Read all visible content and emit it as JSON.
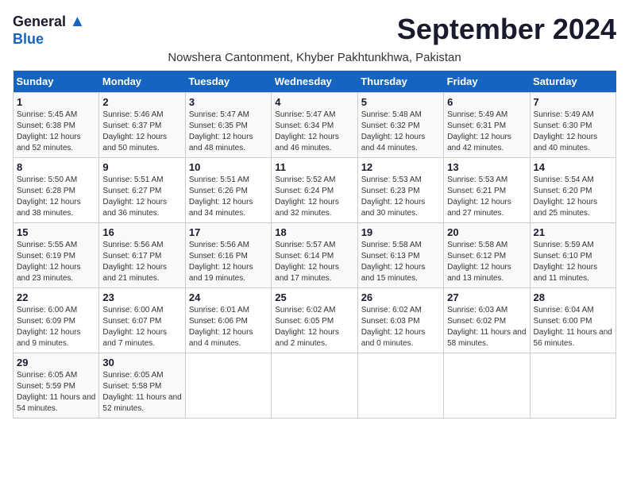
{
  "header": {
    "logo_general": "General",
    "logo_blue": "Blue",
    "month_title": "September 2024",
    "subtitle": "Nowshera Cantonment, Khyber Pakhtunkhwa, Pakistan"
  },
  "weekdays": [
    "Sunday",
    "Monday",
    "Tuesday",
    "Wednesday",
    "Thursday",
    "Friday",
    "Saturday"
  ],
  "days": [
    {
      "num": "",
      "sunrise": "",
      "sunset": "",
      "daylight": "",
      "empty": true
    },
    {
      "num": "1",
      "sunrise": "Sunrise: 5:45 AM",
      "sunset": "Sunset: 6:38 PM",
      "daylight": "Daylight: 12 hours and 52 minutes."
    },
    {
      "num": "2",
      "sunrise": "Sunrise: 5:46 AM",
      "sunset": "Sunset: 6:37 PM",
      "daylight": "Daylight: 12 hours and 50 minutes."
    },
    {
      "num": "3",
      "sunrise": "Sunrise: 5:47 AM",
      "sunset": "Sunset: 6:35 PM",
      "daylight": "Daylight: 12 hours and 48 minutes."
    },
    {
      "num": "4",
      "sunrise": "Sunrise: 5:47 AM",
      "sunset": "Sunset: 6:34 PM",
      "daylight": "Daylight: 12 hours and 46 minutes."
    },
    {
      "num": "5",
      "sunrise": "Sunrise: 5:48 AM",
      "sunset": "Sunset: 6:32 PM",
      "daylight": "Daylight: 12 hours and 44 minutes."
    },
    {
      "num": "6",
      "sunrise": "Sunrise: 5:49 AM",
      "sunset": "Sunset: 6:31 PM",
      "daylight": "Daylight: 12 hours and 42 minutes."
    },
    {
      "num": "7",
      "sunrise": "Sunrise: 5:49 AM",
      "sunset": "Sunset: 6:30 PM",
      "daylight": "Daylight: 12 hours and 40 minutes."
    },
    {
      "num": "8",
      "sunrise": "Sunrise: 5:50 AM",
      "sunset": "Sunset: 6:28 PM",
      "daylight": "Daylight: 12 hours and 38 minutes."
    },
    {
      "num": "9",
      "sunrise": "Sunrise: 5:51 AM",
      "sunset": "Sunset: 6:27 PM",
      "daylight": "Daylight: 12 hours and 36 minutes."
    },
    {
      "num": "10",
      "sunrise": "Sunrise: 5:51 AM",
      "sunset": "Sunset: 6:26 PM",
      "daylight": "Daylight: 12 hours and 34 minutes."
    },
    {
      "num": "11",
      "sunrise": "Sunrise: 5:52 AM",
      "sunset": "Sunset: 6:24 PM",
      "daylight": "Daylight: 12 hours and 32 minutes."
    },
    {
      "num": "12",
      "sunrise": "Sunrise: 5:53 AM",
      "sunset": "Sunset: 6:23 PM",
      "daylight": "Daylight: 12 hours and 30 minutes."
    },
    {
      "num": "13",
      "sunrise": "Sunrise: 5:53 AM",
      "sunset": "Sunset: 6:21 PM",
      "daylight": "Daylight: 12 hours and 27 minutes."
    },
    {
      "num": "14",
      "sunrise": "Sunrise: 5:54 AM",
      "sunset": "Sunset: 6:20 PM",
      "daylight": "Daylight: 12 hours and 25 minutes."
    },
    {
      "num": "15",
      "sunrise": "Sunrise: 5:55 AM",
      "sunset": "Sunset: 6:19 PM",
      "daylight": "Daylight: 12 hours and 23 minutes."
    },
    {
      "num": "16",
      "sunrise": "Sunrise: 5:56 AM",
      "sunset": "Sunset: 6:17 PM",
      "daylight": "Daylight: 12 hours and 21 minutes."
    },
    {
      "num": "17",
      "sunrise": "Sunrise: 5:56 AM",
      "sunset": "Sunset: 6:16 PM",
      "daylight": "Daylight: 12 hours and 19 minutes."
    },
    {
      "num": "18",
      "sunrise": "Sunrise: 5:57 AM",
      "sunset": "Sunset: 6:14 PM",
      "daylight": "Daylight: 12 hours and 17 minutes."
    },
    {
      "num": "19",
      "sunrise": "Sunrise: 5:58 AM",
      "sunset": "Sunset: 6:13 PM",
      "daylight": "Daylight: 12 hours and 15 minutes."
    },
    {
      "num": "20",
      "sunrise": "Sunrise: 5:58 AM",
      "sunset": "Sunset: 6:12 PM",
      "daylight": "Daylight: 12 hours and 13 minutes."
    },
    {
      "num": "21",
      "sunrise": "Sunrise: 5:59 AM",
      "sunset": "Sunset: 6:10 PM",
      "daylight": "Daylight: 12 hours and 11 minutes."
    },
    {
      "num": "22",
      "sunrise": "Sunrise: 6:00 AM",
      "sunset": "Sunset: 6:09 PM",
      "daylight": "Daylight: 12 hours and 9 minutes."
    },
    {
      "num": "23",
      "sunrise": "Sunrise: 6:00 AM",
      "sunset": "Sunset: 6:07 PM",
      "daylight": "Daylight: 12 hours and 7 minutes."
    },
    {
      "num": "24",
      "sunrise": "Sunrise: 6:01 AM",
      "sunset": "Sunset: 6:06 PM",
      "daylight": "Daylight: 12 hours and 4 minutes."
    },
    {
      "num": "25",
      "sunrise": "Sunrise: 6:02 AM",
      "sunset": "Sunset: 6:05 PM",
      "daylight": "Daylight: 12 hours and 2 minutes."
    },
    {
      "num": "26",
      "sunrise": "Sunrise: 6:02 AM",
      "sunset": "Sunset: 6:03 PM",
      "daylight": "Daylight: 12 hours and 0 minutes."
    },
    {
      "num": "27",
      "sunrise": "Sunrise: 6:03 AM",
      "sunset": "Sunset: 6:02 PM",
      "daylight": "Daylight: 11 hours and 58 minutes."
    },
    {
      "num": "28",
      "sunrise": "Sunrise: 6:04 AM",
      "sunset": "Sunset: 6:00 PM",
      "daylight": "Daylight: 11 hours and 56 minutes."
    },
    {
      "num": "29",
      "sunrise": "Sunrise: 6:05 AM",
      "sunset": "Sunset: 5:59 PM",
      "daylight": "Daylight: 11 hours and 54 minutes."
    },
    {
      "num": "30",
      "sunrise": "Sunrise: 6:05 AM",
      "sunset": "Sunset: 5:58 PM",
      "daylight": "Daylight: 11 hours and 52 minutes."
    },
    {
      "num": "",
      "sunrise": "",
      "sunset": "",
      "daylight": "",
      "empty": true
    },
    {
      "num": "",
      "sunrise": "",
      "sunset": "",
      "daylight": "",
      "empty": true
    },
    {
      "num": "",
      "sunrise": "",
      "sunset": "",
      "daylight": "",
      "empty": true
    },
    {
      "num": "",
      "sunrise": "",
      "sunset": "",
      "daylight": "",
      "empty": true
    },
    {
      "num": "",
      "sunrise": "",
      "sunset": "",
      "daylight": "",
      "empty": true
    }
  ]
}
